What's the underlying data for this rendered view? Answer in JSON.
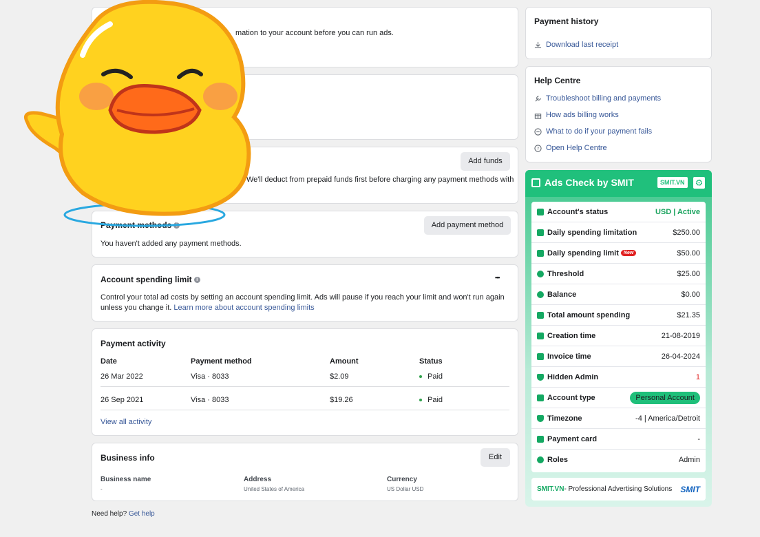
{
  "notice": {
    "text": "mation to your account before you can run ads."
  },
  "prepaid": {
    "text": "We'll deduct from prepaid funds first before charging any payment methods with",
    "add_funds": "Add funds"
  },
  "payment_methods": {
    "title": "Payment methods",
    "button": "Add payment method",
    "empty": "You haven't added any payment methods."
  },
  "spending_limit": {
    "title": "Account spending limit",
    "more": "•••",
    "desc1": "Control your total ad costs by setting an account spending limit. Ads will pause if you reach your limit and won't run again",
    "desc2": "unless you change it.",
    "learn_more": "Learn more about account spending limits"
  },
  "activity": {
    "title": "Payment activity",
    "headers": [
      "Date",
      "Payment method",
      "Amount",
      "Status"
    ],
    "rows": [
      {
        "date": "26 Mar 2022",
        "method": "Visa · 8033",
        "amount": "$2.09",
        "status": "Paid"
      },
      {
        "date": "26 Sep 2021",
        "method": "Visa · 8033",
        "amount": "$19.26",
        "status": "Paid"
      }
    ],
    "view_all": "View all activity"
  },
  "business": {
    "title": "Business info",
    "edit": "Edit",
    "fields": [
      {
        "label": "Business name",
        "value": "-"
      },
      {
        "label": "Address",
        "value": "United States of America"
      },
      {
        "label": "Currency",
        "value": "US Dollar USD"
      }
    ]
  },
  "footer": {
    "need_help": "Need help?",
    "get_help": "Get help"
  },
  "payment_history": {
    "title": "Payment history",
    "download": "Download last receipt"
  },
  "help_centre": {
    "title": "Help Centre",
    "items": [
      "Troubleshoot billing and payments",
      "How ads billing works",
      "What to do if your payment fails",
      "Open Help Centre"
    ]
  },
  "smit": {
    "title": "Ads Check by SMIT",
    "badge": "SMIT.VN",
    "rows": [
      {
        "label": "Account's status",
        "value": "USD | Active"
      },
      {
        "label": "Daily spending limitation",
        "value": "$250.00"
      },
      {
        "label": "Daily spending limit",
        "value": "$50.00",
        "badge": "New"
      },
      {
        "label": "Threshold",
        "value": "$25.00"
      },
      {
        "label": "Balance",
        "value": "$0.00"
      },
      {
        "label": "Total amount spending",
        "value": "$21.35"
      },
      {
        "label": "Creation time",
        "value": "21-08-2019"
      },
      {
        "label": "Invoice time",
        "value": "26-04-2024"
      },
      {
        "label": "Hidden Admin",
        "value": "1"
      },
      {
        "label": "Account type",
        "value": "Personal Account"
      },
      {
        "label": "Timezone",
        "value": "-4 | America/Detroit"
      },
      {
        "label": "Payment card",
        "value": "-"
      },
      {
        "label": "Roles",
        "value": "Admin"
      }
    ],
    "footer_brand": "SMIT.VN",
    "footer_text": " - Professional Advertising Solutions",
    "footer_logo": "SMIT",
    "colors": {
      "green": "#20c07c",
      "status_green": "#1aa35e",
      "red": "#e02020"
    }
  }
}
